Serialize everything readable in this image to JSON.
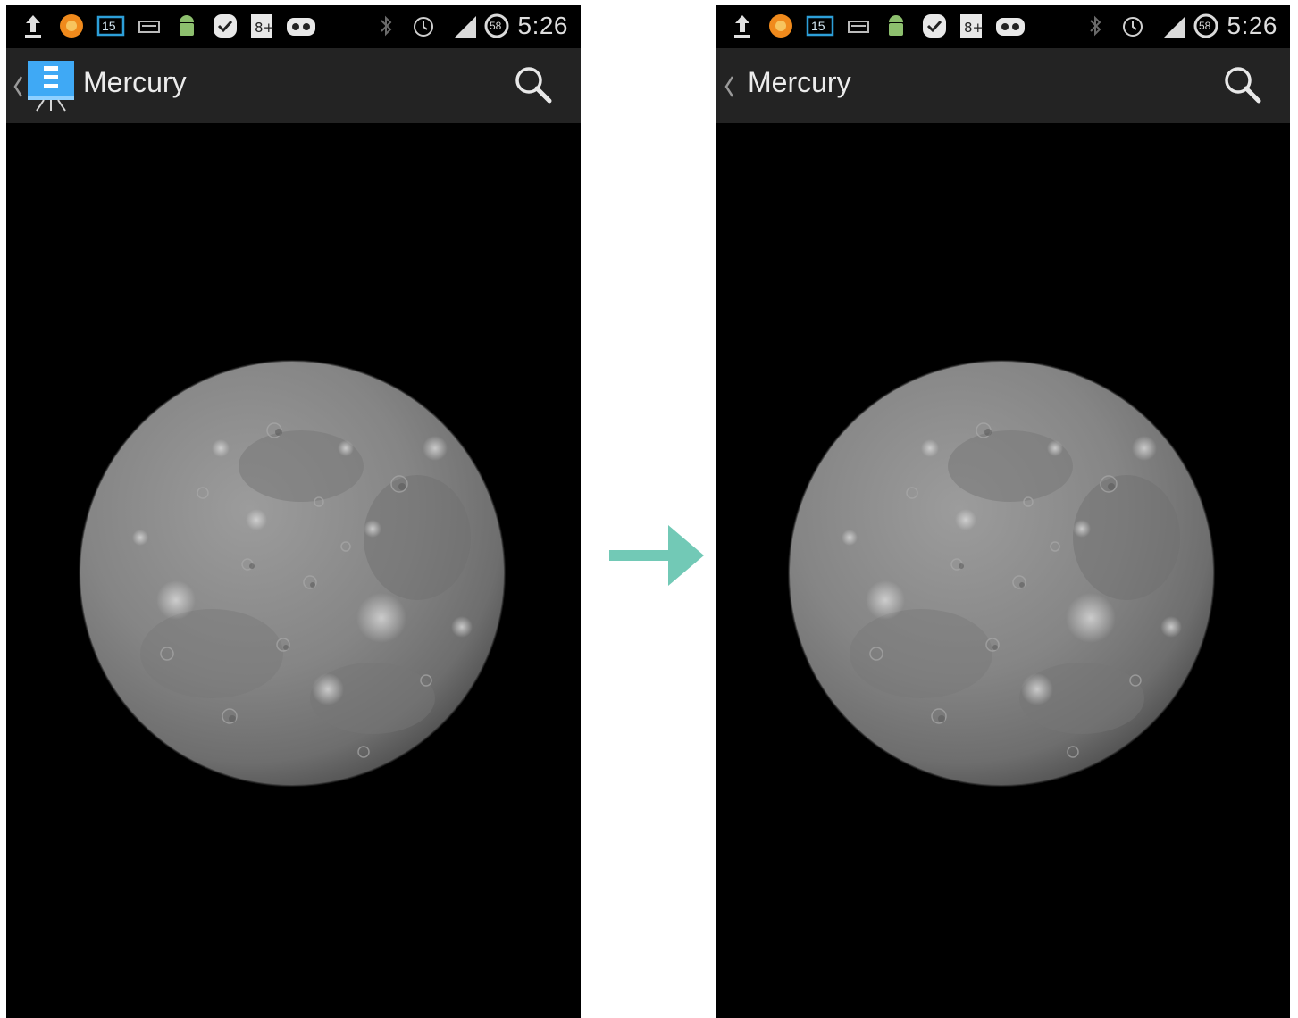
{
  "colors": {
    "status_bar_bg": "#000000",
    "action_bar_bg": "#232323",
    "screen_bg": "#000000",
    "arrow": "#72c9b6",
    "app_icon_blue": "#3fa9f5"
  },
  "transition_arrow_icon": "right-arrow-icon",
  "screens": {
    "before": {
      "status_icons": [
        "upload-icon",
        "firefox-icon",
        "calendar-icon",
        "news-icon",
        "android-icon",
        "tasks-icon",
        "google-plus-icon",
        "cyanogen-icon",
        "bluetooth-icon",
        "alarm-icon",
        "signal-icon",
        "battery-icon"
      ],
      "calendar_badge": "15",
      "battery_level": "58",
      "clock": "5:26",
      "title": "Mercury",
      "shows_app_icon": true
    },
    "after": {
      "status_icons": [
        "upload-icon",
        "firefox-icon",
        "calendar-icon",
        "news-icon",
        "android-icon",
        "tasks-icon",
        "google-plus-icon",
        "cyanogen-icon",
        "bluetooth-icon",
        "alarm-icon",
        "signal-icon",
        "battery-icon"
      ],
      "calendar_badge": "15",
      "battery_level": "58",
      "clock": "5:26",
      "title": "Mercury",
      "shows_app_icon": false
    }
  }
}
